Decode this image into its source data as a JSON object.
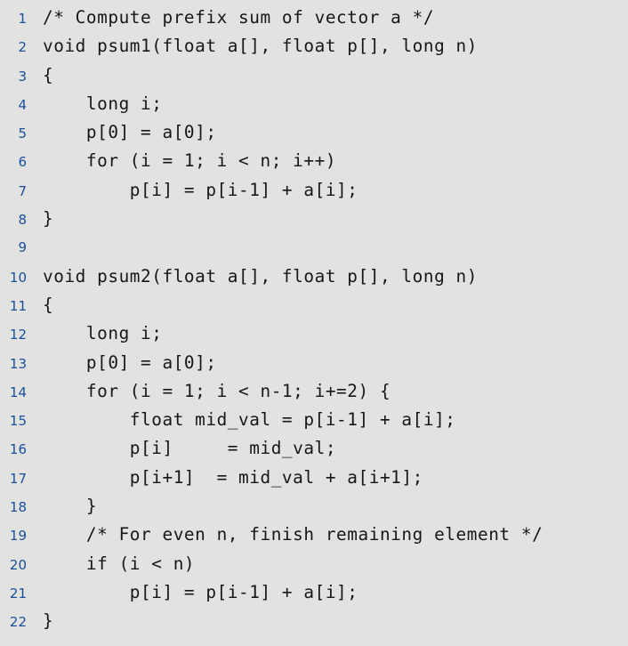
{
  "listing": {
    "language": "c",
    "background_color": "#e2e2e1",
    "line_number_color": "#1a4f9c",
    "code_color": "#171717",
    "first_line_number": 1,
    "last_line_number": 22,
    "lines": [
      {
        "number": "1",
        "code": "/* Compute prefix sum of vector a */"
      },
      {
        "number": "2",
        "code": "void psum1(float a[], float p[], long n)"
      },
      {
        "number": "3",
        "code": "{"
      },
      {
        "number": "4",
        "code": "    long i;"
      },
      {
        "number": "5",
        "code": "    p[0] = a[0];"
      },
      {
        "number": "6",
        "code": "    for (i = 1; i < n; i++)"
      },
      {
        "number": "7",
        "code": "        p[i] = p[i-1] + a[i];"
      },
      {
        "number": "8",
        "code": "}"
      },
      {
        "number": "9",
        "code": ""
      },
      {
        "number": "10",
        "code": "void psum2(float a[], float p[], long n)"
      },
      {
        "number": "11",
        "code": "{"
      },
      {
        "number": "12",
        "code": "    long i;"
      },
      {
        "number": "13",
        "code": "    p[0] = a[0];"
      },
      {
        "number": "14",
        "code": "    for (i = 1; i < n-1; i+=2) {"
      },
      {
        "number": "15",
        "code": "        float mid_val = p[i-1] + a[i];"
      },
      {
        "number": "16",
        "code": "        p[i]     = mid_val;"
      },
      {
        "number": "17",
        "code": "        p[i+1]  = mid_val + a[i+1];"
      },
      {
        "number": "18",
        "code": "    }"
      },
      {
        "number": "19",
        "code": "    /* For even n, finish remaining element */"
      },
      {
        "number": "20",
        "code": "    if (i < n)"
      },
      {
        "number": "21",
        "code": "        p[i] = p[i-1] + a[i];"
      },
      {
        "number": "22",
        "code": "}"
      }
    ]
  }
}
